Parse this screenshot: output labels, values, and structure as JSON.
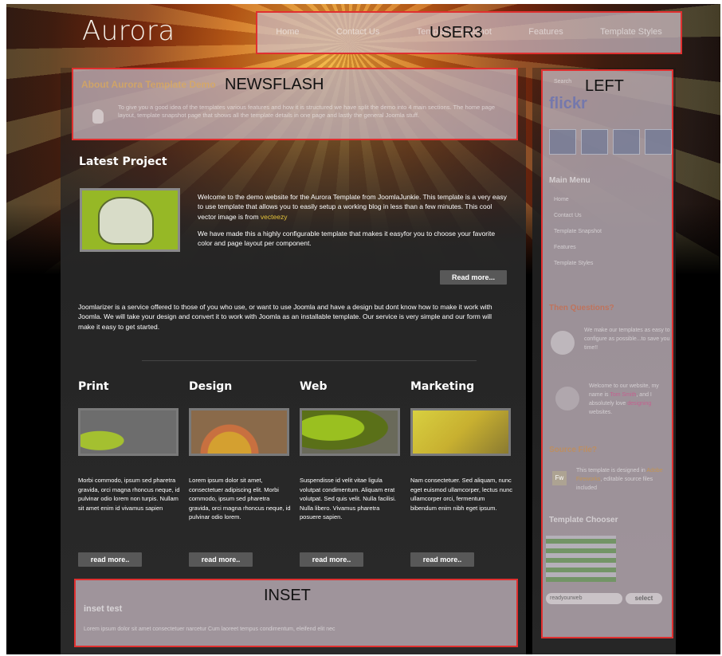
{
  "logo": "Aurora",
  "user3": {
    "label": "USER3",
    "nav": [
      "Home",
      "Contact Us",
      "Template Snapshot",
      "Features",
      "Template Styles"
    ]
  },
  "newsflash": {
    "label": "NEWSFLASH",
    "title": "About Aurora Template Demo",
    "body": "To give you a good idea of the templates various features and how it is structured we have split the demo into 4 main sections. The home page layout, template snapshot page that shows all the template details in one page and lastly the general Joomla stuff."
  },
  "latest": {
    "title": "Latest Project",
    "para1": "Welcome to the demo website for the Aurora Template from JoomlaJunkie. This template is a very easy to use template that allows you to easily setup a working blog in less than a few minutes. This cool vector image is from",
    "para1_link": "vecteezy",
    "para2": "We have made this a highly configurable template that makes it easyfor you to choose your favorite color and page layout per component.",
    "read_more": "Read more..."
  },
  "joomlarizer": "Joomlarizer is a service offered to those of you who use, or want to use Joomla and have a design but dont know how to make it work with Joomla. We will take your design and convert it to work with Joomla as an installable template. Our service is very simple and our form will make it easy to get started.",
  "columns": [
    {
      "title": "Print",
      "text": "Morbi commodo, ipsum sed pharetra gravida, orci magna rhoncus neque, id pulvinar odio lorem non turpis. Nullam sit amet enim id vivamus sapien",
      "button": "read more.."
    },
    {
      "title": "Design",
      "text": "Lorem ipsum dolor sit amet, consectetuer adipiscing elit. Morbi commodo, ipsum sed pharetra gravida, orci magna rhoncus neque, id pulvinar odio lorem.",
      "button": "read more.."
    },
    {
      "title": "Web",
      "text": "Suspendisse id velit vitae ligula volutpat condimentum. Aliquam erat volutpat. Sed quis velit. Nulla facilisi. Nulla libero. Vivamus pharetra posuere sapien.",
      "button": "read more.."
    },
    {
      "title": "Marketing",
      "text": "Nam consectetuer. Sed aliquam, nunc eget euismod ullamcorper, lectus nunc ullamcorper orci, fermentum bibendum enim nibh eget ipsum.",
      "button": "read more.."
    }
  ],
  "inset": {
    "label": "INSET",
    "title": "inset test",
    "body": "Lorem ipsum dolor sit amet consectetuer narcetur Cum laoreet tempus condimentum, eleifend elit nec"
  },
  "left": {
    "label": "LEFT",
    "search_label": "Search",
    "flickr": "flickr",
    "main_menu_title": "Main Menu",
    "main_menu": [
      "Home",
      "Contact Us",
      "Template Snapshot",
      "Features",
      "Template Styles"
    ],
    "questions_title": "Then Questions?",
    "questions_text": "We make our templates as easy to configure as possible...to save you time!!",
    "welcome_pre": "Welcome to our website, my name is",
    "welcome_name": "Tom Smith",
    "welcome_mid": ", and I absolutely love",
    "welcome_link": "designing",
    "welcome_post": "websites.",
    "source_title": "Source File?",
    "source_pre": "This template is designed in",
    "source_link": "Adobe Fireworks",
    "source_post": ", editable source files included",
    "source_icon": "Fw",
    "chooser_title": "Template Chooser",
    "chooser_select": "readyourweb",
    "chooser_button": "select"
  }
}
